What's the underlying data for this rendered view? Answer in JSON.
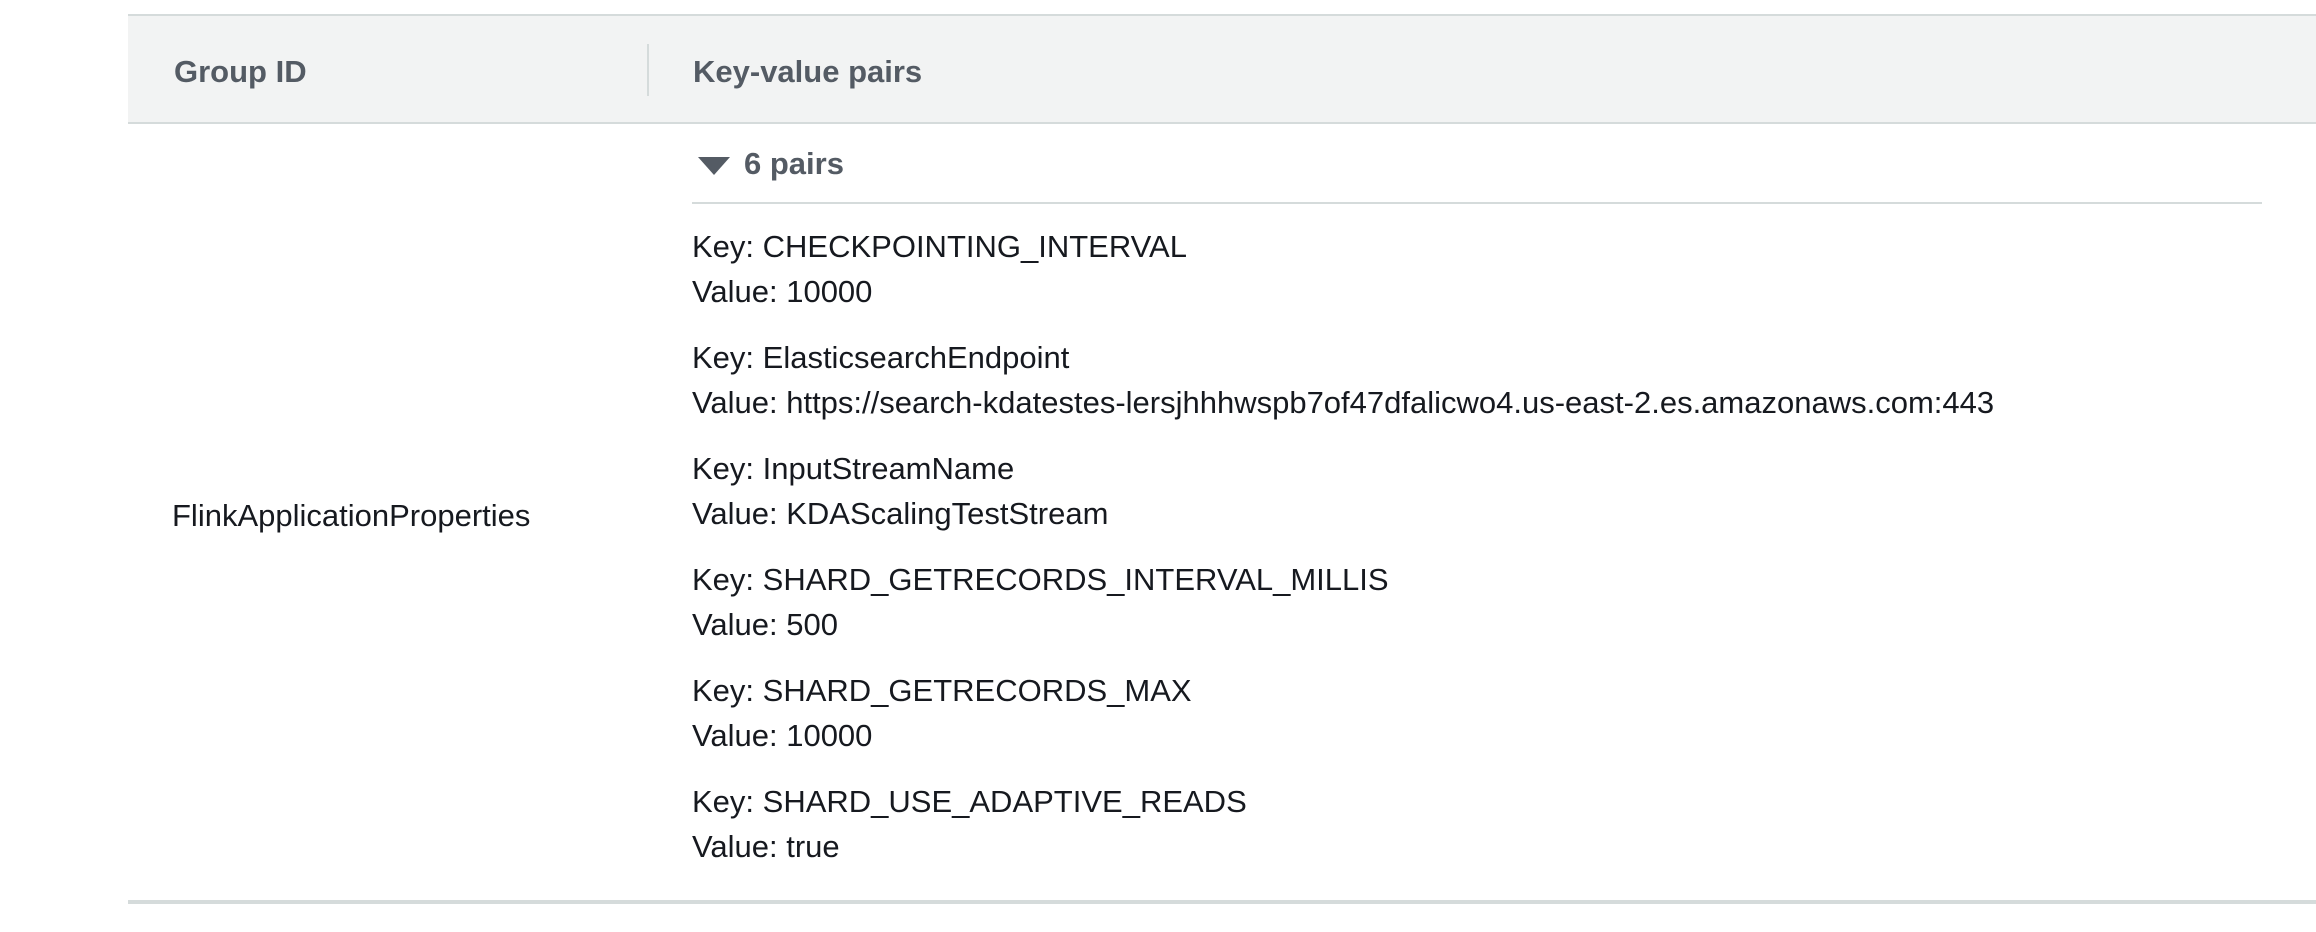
{
  "table": {
    "columns": [
      "Group ID",
      "Key-value pairs"
    ],
    "rows": [
      {
        "group_id": "FlinkApplicationProperties",
        "pairs_summary": "6 pairs",
        "pairs": [
          {
            "key": "Key: CHECKPOINTING_INTERVAL",
            "value": "Value: 10000"
          },
          {
            "key": "Key: ElasticsearchEndpoint",
            "value": "Value: https://search-kdatestes-lersjhhhwspb7of47dfalicwo4.us-east-2.es.amazonaws.com:443"
          },
          {
            "key": "Key: InputStreamName",
            "value": "Value: KDAScalingTestStream"
          },
          {
            "key": "Key: SHARD_GETRECORDS_INTERVAL_MILLIS",
            "value": "Value: 500"
          },
          {
            "key": "Key: SHARD_GETRECORDS_MAX",
            "value": "Value: 10000"
          },
          {
            "key": "Key: SHARD_USE_ADAPTIVE_READS",
            "value": "Value: true"
          }
        ]
      }
    ]
  },
  "icons": {
    "expander": "caret-down-icon"
  },
  "colors": {
    "header_background": "#f2f3f3",
    "header_text": "#545b64",
    "body_text": "#16191f",
    "border": "#d5dbdb"
  }
}
